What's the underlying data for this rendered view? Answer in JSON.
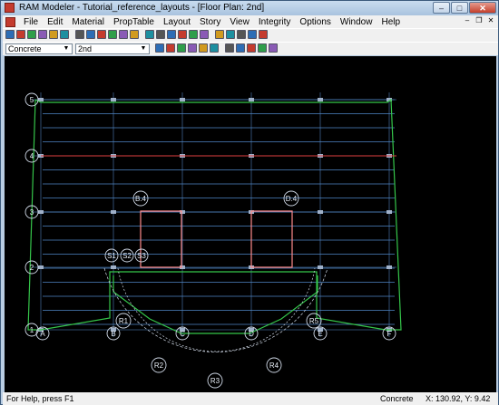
{
  "window": {
    "title": "RAM Modeler - Tutorial_reference_layouts - [Floor Plan: 2nd]",
    "min_label": "–",
    "max_label": "□",
    "close_label": "✕"
  },
  "menu": [
    "File",
    "Edit",
    "Material",
    "PropTable",
    "Layout",
    "Story",
    "View",
    "Integrity",
    "Options",
    "Window",
    "Help"
  ],
  "toolbar2": {
    "material_select": "Concrete",
    "story_select": "2nd"
  },
  "toolbar_icons_row1": [
    "save-icon",
    "print-icon",
    "beam-icon",
    "column-icon",
    "brace-icon",
    "wall-icon",
    "slab-icon",
    "deck-icon",
    "opening-icon",
    "grid-icon",
    "layout-icon",
    "property-icon",
    "cut-icon",
    "copy-icon",
    "paste-icon",
    "undo-icon",
    "redo-icon",
    "zoom-in-icon",
    "zoom-out-icon",
    "zoom-window-icon",
    "pan-icon",
    "redraw-icon",
    "help-icon"
  ],
  "toolbar_icons_row2": [
    "snap-grid-icon",
    "snap-point-icon",
    "delete-icon",
    "select-icon",
    "assign-icon",
    "frame-icon",
    "load-icon",
    "display-icon",
    "filter-icon",
    "view-icon",
    "layer-icon"
  ],
  "plan": {
    "grid_rows": [
      "5",
      "4",
      "3",
      "2",
      "1"
    ],
    "grid_cols": [
      "A",
      "B",
      "C",
      "D",
      "E",
      "F"
    ],
    "grid_bubbles_mid": [
      "B.4",
      "D.4"
    ],
    "radial_bubbles": [
      "R1",
      "R2",
      "R3",
      "R4",
      "R5"
    ],
    "s_bubbles": [
      "S1",
      "S2",
      "S3"
    ]
  },
  "status": {
    "help_text": "For Help, press F1",
    "material": "Concrete",
    "coords": "X: 130.92, Y:   9.42"
  },
  "colors": {
    "canvas_bg": "#000000",
    "grid_line": "#3b5f8c",
    "beam": "#7fb7ff",
    "outline": "#35c54a",
    "girder_red": "#e04040",
    "opening": "#ff8a8a"
  }
}
